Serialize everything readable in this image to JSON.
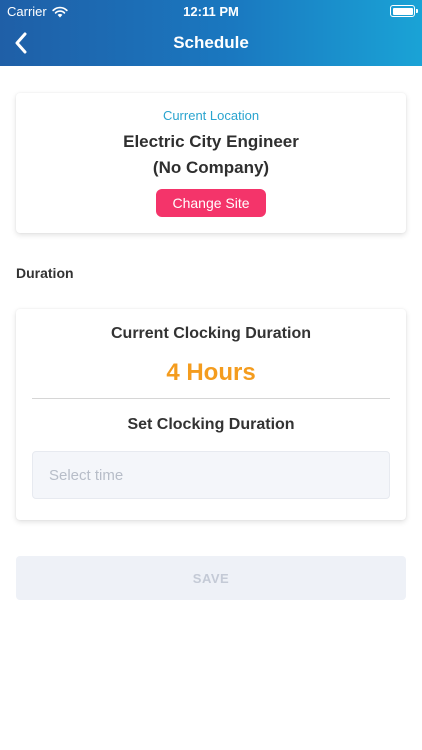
{
  "status_bar": {
    "carrier": "Carrier",
    "time": "12:11 PM"
  },
  "nav": {
    "title": "Schedule",
    "back_icon": "chevron-left-icon"
  },
  "location": {
    "label": "Current Location",
    "name_line1": "Electric City Engineer",
    "name_line2": "(No Company)",
    "change_site_label": "Change Site"
  },
  "duration": {
    "section_title": "Duration",
    "current_label": "Current Clocking Duration",
    "current_value": "4 Hours",
    "set_label": "Set Clocking Duration",
    "time_placeholder": "Select time"
  },
  "actions": {
    "save_label": "SAVE"
  },
  "colors": {
    "header_start": "#1f5fa7",
    "header_end": "#1aa3d6",
    "accent_pink": "#f4346a",
    "accent_orange": "#f49c1e",
    "location_label": "#2aa4cf"
  }
}
